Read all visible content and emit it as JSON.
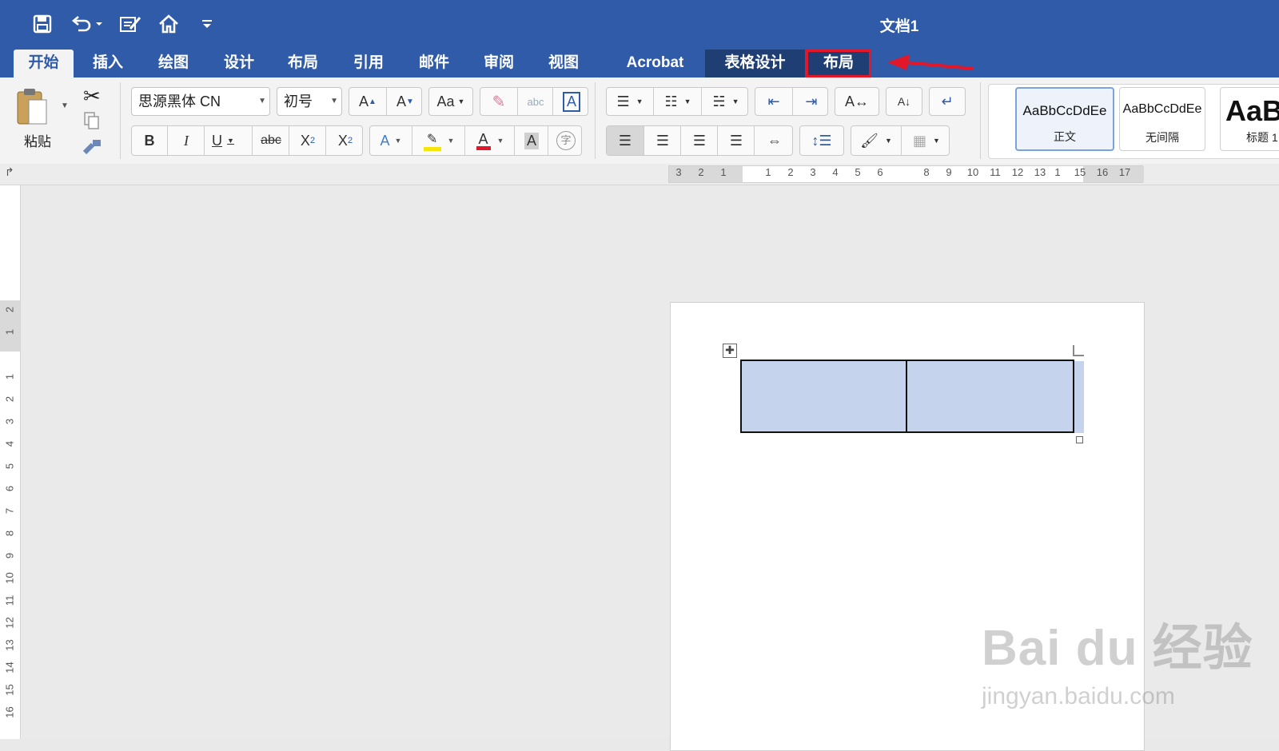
{
  "window": {
    "title": "文档1"
  },
  "quick_access": {
    "customize_icon": "chevron-down-icon"
  },
  "tabs": [
    {
      "label": "开始",
      "state": "active"
    },
    {
      "label": "插入"
    },
    {
      "label": "绘图"
    },
    {
      "label": "设计"
    },
    {
      "label": "布局"
    },
    {
      "label": "引用"
    },
    {
      "label": "邮件"
    },
    {
      "label": "审阅"
    },
    {
      "label": "视图"
    },
    {
      "label": "Acrobat"
    },
    {
      "label": "表格设计",
      "state": "contextual"
    },
    {
      "label": "布局",
      "state": "contextual-highlighted"
    }
  ],
  "clipboard": {
    "paste_label": "粘贴"
  },
  "font": {
    "family": "思源黑体 CN",
    "size": "初号"
  },
  "format_buttons": {
    "bold": "B",
    "italic": "I",
    "underline": "U",
    "strikethrough": "abc",
    "subscript": "X",
    "subscript_mark": "2",
    "superscript": "X",
    "superscript_mark": "2",
    "grow": "A",
    "shrink": "A",
    "case": "Aa",
    "text_effects": "A",
    "font_color": "A",
    "char_shading": "A",
    "phonetic": "字",
    "border_char": "A",
    "clear_ab": "abc"
  },
  "colors": {
    "accent": "#2f5ba8",
    "highlight": "#f5e50a",
    "font_color": "#e3172a",
    "arrow": "#e3172a",
    "selection": "#c6d3ec"
  },
  "styles": [
    {
      "sample": "AaBbCcDdEe",
      "name": "正文",
      "selected": true
    },
    {
      "sample": "AaBbCcDdEe",
      "name": "无间隔"
    },
    {
      "sample": "AaB",
      "name": "标题 1"
    }
  ],
  "ruler": {
    "horizontal": [
      "3",
      "2",
      "1",
      "1",
      "2",
      "3",
      "4",
      "5",
      "6",
      "8",
      "9",
      "10",
      "11",
      "12",
      "13",
      "1",
      "15",
      "16",
      "17"
    ],
    "vertical": [
      "2",
      "1",
      "1",
      "2",
      "3",
      "4",
      "5",
      "6",
      "7",
      "8",
      "9",
      "10",
      "11",
      "12",
      "13",
      "14",
      "15",
      "16"
    ]
  },
  "watermark": {
    "brand": "Bai du 经验",
    "url": "jingyan.baidu.com"
  }
}
